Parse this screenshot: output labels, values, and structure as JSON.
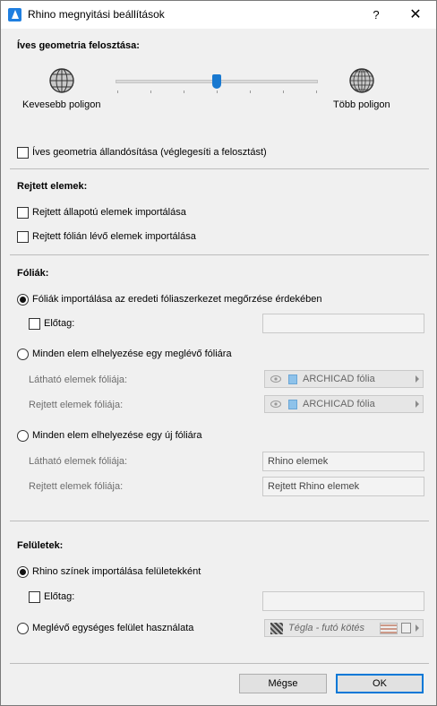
{
  "window": {
    "title": "Rhino megnyitási beállítások",
    "help": "?",
    "close": "✕"
  },
  "tessellation": {
    "heading": "Íves geometria felosztása:",
    "less_label": "Kevesebb poligon",
    "more_label": "Több poligon",
    "slider_level": 0.5,
    "freeze_label": "Íves geometria állandósítása (véglegesíti a felosztást)",
    "freeze_checked": false
  },
  "hidden": {
    "heading": "Rejtett elemek:",
    "import_hidden_state": "Rejtett állapotú elemek importálása",
    "import_hidden_state_checked": false,
    "import_hidden_layer": "Rejtett fólián lévő elemek importálása",
    "import_hidden_layer_checked": false
  },
  "layers": {
    "heading": "Fóliák:",
    "opt_keep": "Fóliák importálása az eredeti fóliaszerkezet megőrzése érdekében",
    "prefix_label": "Előtag:",
    "prefix_value": "",
    "opt_existing": "Minden elem elhelyezése egy meglévő fóliára",
    "visible_layer_label": "Látható elemek fóliája:",
    "hidden_layer_label": "Rejtett elemek fóliája:",
    "existing_visible_value": "ARCHICAD fólia",
    "existing_hidden_value": "ARCHICAD fólia",
    "opt_new": "Minden elem elhelyezése egy új fóliára",
    "new_visible_label": "Látható elemek fóliája:",
    "new_hidden_label": "Rejtett elemek fóliája:",
    "new_visible_value": "Rhino elemek",
    "new_hidden_value": "Rejtett Rhino elemek",
    "selected": "keep"
  },
  "surfaces": {
    "heading": "Felületek:",
    "opt_rhino_colors": "Rhino színek importálása felületekként",
    "prefix_label": "Előtag:",
    "prefix_value": "",
    "opt_uniform": "Meglévő egységes felület használata",
    "uniform_value": "Tégla - futó kötés",
    "selected": "rhino_colors"
  },
  "buttons": {
    "cancel": "Mégse",
    "ok": "OK"
  },
  "colors": {
    "accent": "#0078d7",
    "slider_thumb": "#1979d0"
  }
}
